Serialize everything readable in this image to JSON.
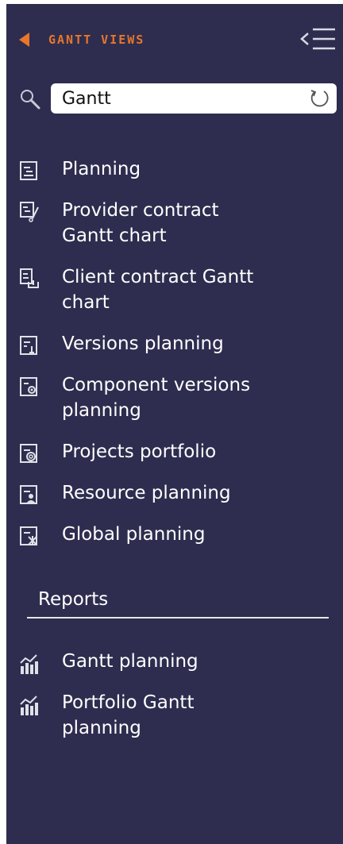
{
  "header": {
    "title": "GANTT VIEWS",
    "accent_color": "#e8762b",
    "back_icon": "back-arrow-icon",
    "collapse_icon": "collapse-menu-icon"
  },
  "search": {
    "value": "Gantt",
    "icon": "search-icon",
    "reset_icon": "reset-icon"
  },
  "gantt_views": [
    {
      "label_lines": [
        "Planning"
      ],
      "icon": "planning-icon"
    },
    {
      "label_lines": [
        "Provider contract",
        "Gantt chart"
      ],
      "icon": "provider-contract-icon"
    },
    {
      "label_lines": [
        "Client contract Gantt",
        "chart"
      ],
      "icon": "client-contract-icon"
    },
    {
      "label_lines": [
        "Versions planning"
      ],
      "icon": "versions-planning-icon"
    },
    {
      "label_lines": [
        "Component versions",
        "planning"
      ],
      "icon": "component-versions-icon"
    },
    {
      "label_lines": [
        "Projects portfolio"
      ],
      "icon": "projects-portfolio-icon"
    },
    {
      "label_lines": [
        "Resource planning"
      ],
      "icon": "resource-planning-icon"
    },
    {
      "label_lines": [
        "Global planning"
      ],
      "icon": "global-planning-icon"
    }
  ],
  "reports": {
    "title": "Reports",
    "items": [
      {
        "label_lines": [
          "Gantt planning"
        ],
        "icon": "bar-chart-icon"
      },
      {
        "label_lines": [
          "Portfolio Gantt",
          "planning"
        ],
        "icon": "bar-chart-icon"
      }
    ]
  },
  "colors": {
    "panel_background": "#2e2d4f",
    "text": "#ffffff"
  }
}
